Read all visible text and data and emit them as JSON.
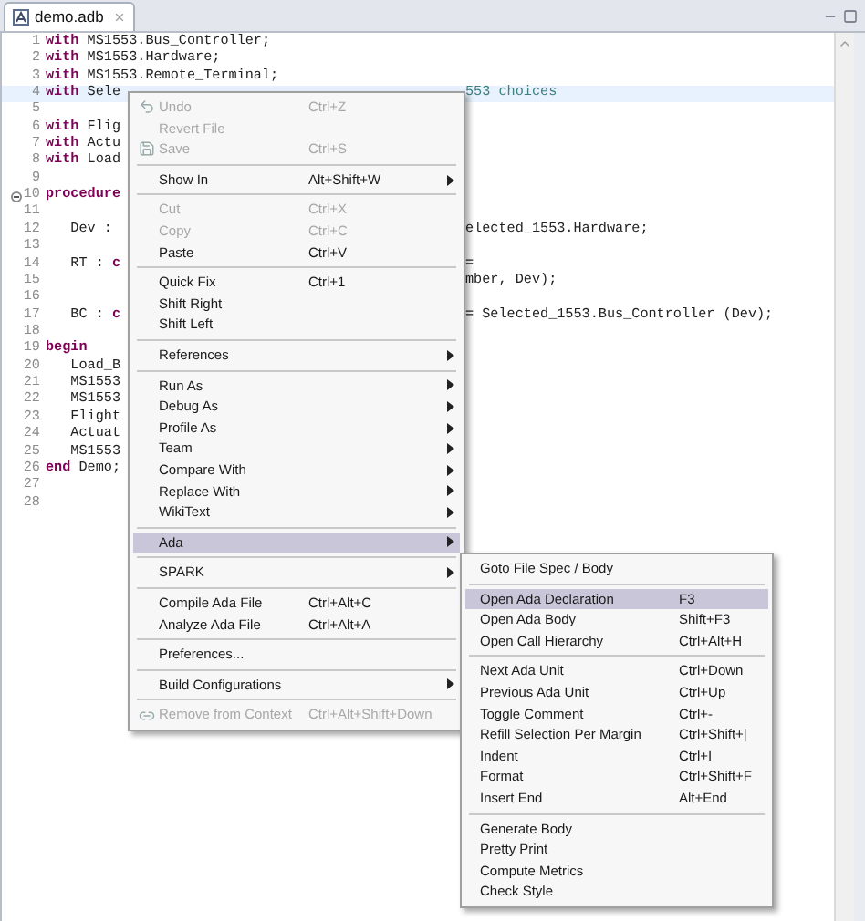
{
  "editor_tab": {
    "title": "demo.adb",
    "selected": true
  },
  "lines": [
    {
      "number": "1",
      "current": false,
      "tokens": [
        {
          "text": "with",
          "kind": "keyword"
        },
        {
          "text": " MS1553.Bus_Controller;",
          "kind": "plain"
        }
      ]
    },
    {
      "number": "2",
      "current": false,
      "tokens": [
        {
          "text": "with",
          "kind": "keyword"
        },
        {
          "text": " MS1553.Hardware;",
          "kind": "plain"
        }
      ]
    },
    {
      "number": "3",
      "current": false,
      "tokens": [
        {
          "text": "with",
          "kind": "keyword"
        },
        {
          "text": " MS1553.Remote_Terminal;",
          "kind": "plain"
        }
      ]
    },
    {
      "number": "4",
      "current": true,
      "tokens": [
        {
          "text": "with",
          "kind": "keyword"
        },
        {
          "text": " Sele",
          "kind": "plain"
        }
      ],
      "right": [
        {
          "text": "553 choices",
          "kind": "comment"
        }
      ]
    },
    {
      "number": "5",
      "current": false
    },
    {
      "number": "6",
      "current": false,
      "tokens": [
        {
          "text": "with",
          "kind": "keyword"
        },
        {
          "text": " Flig",
          "kind": "plain"
        }
      ]
    },
    {
      "number": "7",
      "current": false,
      "tokens": [
        {
          "text": "with",
          "kind": "keyword"
        },
        {
          "text": " Actu",
          "kind": "plain"
        }
      ]
    },
    {
      "number": "8",
      "current": false,
      "tokens": [
        {
          "text": "with",
          "kind": "keyword"
        },
        {
          "text": " Load",
          "kind": "plain"
        }
      ]
    },
    {
      "number": "9",
      "current": false
    },
    {
      "number": "10",
      "current": false,
      "fold_marker": true,
      "tokens": [
        {
          "text": "procedure",
          "kind": "keyword"
        }
      ]
    },
    {
      "number": "11",
      "current": false
    },
    {
      "number": "12",
      "current": false,
      "tokens": [
        {
          "text": "   Dev :",
          "kind": "plain"
        }
      ],
      "right": [
        {
          "text": "elected_1553.Hardware;",
          "kind": "plain"
        }
      ]
    },
    {
      "number": "13",
      "current": false
    },
    {
      "number": "14",
      "current": false,
      "tokens": [
        {
          "text": "   RT : ",
          "kind": "plain"
        },
        {
          "text": "c",
          "kind": "keyword"
        }
      ],
      "right": [
        {
          "text": "=",
          "kind": "plain"
        }
      ]
    },
    {
      "number": "15",
      "current": false,
      "right": [
        {
          "text": "mber, Dev);",
          "kind": "plain"
        }
      ]
    },
    {
      "number": "16",
      "current": false
    },
    {
      "number": "17",
      "current": false,
      "tokens": [
        {
          "text": "   BC : ",
          "kind": "plain"
        },
        {
          "text": "c",
          "kind": "keyword"
        }
      ],
      "right": [
        {
          "text": "= Selected_1553.Bus_Controller (Dev);",
          "kind": "plain"
        }
      ]
    },
    {
      "number": "18",
      "current": false
    },
    {
      "number": "19",
      "current": false,
      "tokens": [
        {
          "text": "begin",
          "kind": "keyword"
        }
      ]
    },
    {
      "number": "20",
      "current": false,
      "tokens": [
        {
          "text": "   Load_B",
          "kind": "plain"
        }
      ]
    },
    {
      "number": "21",
      "current": false,
      "tokens": [
        {
          "text": "   MS1553",
          "kind": "plain"
        }
      ]
    },
    {
      "number": "22",
      "current": false,
      "tokens": [
        {
          "text": "   MS1553",
          "kind": "plain"
        }
      ]
    },
    {
      "number": "23",
      "current": false,
      "tokens": [
        {
          "text": "   Flight",
          "kind": "plain"
        }
      ]
    },
    {
      "number": "24",
      "current": false,
      "tokens": [
        {
          "text": "   Actuat",
          "kind": "plain"
        }
      ]
    },
    {
      "number": "25",
      "current": false,
      "tokens": [
        {
          "text": "   MS1553",
          "kind": "plain"
        }
      ]
    },
    {
      "number": "26",
      "current": false,
      "tokens": [
        {
          "text": "end",
          "kind": "keyword"
        },
        {
          "text": " Demo;",
          "kind": "plain"
        }
      ]
    },
    {
      "number": "27",
      "current": false
    },
    {
      "number": "28",
      "current": false
    }
  ],
  "context_menu": [
    {
      "kind": "item",
      "label": "Undo",
      "shortcut": "Ctrl+Z",
      "disabled": true,
      "selected": false
    },
    {
      "kind": "item",
      "label": "Revert File",
      "disabled": true,
      "selected": false
    },
    {
      "kind": "item",
      "label": "Save",
      "shortcut": "Ctrl+S",
      "disabled": true,
      "selected": false
    },
    {
      "kind": "separator"
    },
    {
      "kind": "item",
      "label": "Show In",
      "shortcut": "Alt+Shift+W",
      "submenu": true,
      "disabled": false,
      "selected": false
    },
    {
      "kind": "separator"
    },
    {
      "kind": "item",
      "label": "Cut",
      "shortcut": "Ctrl+X",
      "disabled": true,
      "selected": false
    },
    {
      "kind": "item",
      "label": "Copy",
      "shortcut": "Ctrl+C",
      "disabled": true,
      "selected": false
    },
    {
      "kind": "item",
      "label": "Paste",
      "shortcut": "Ctrl+V",
      "disabled": false,
      "selected": false
    },
    {
      "kind": "separator"
    },
    {
      "kind": "item",
      "label": "Quick Fix",
      "shortcut": "Ctrl+1",
      "disabled": false,
      "selected": false
    },
    {
      "kind": "item",
      "label": "Shift Right",
      "disabled": false,
      "selected": false
    },
    {
      "kind": "item",
      "label": "Shift Left",
      "disabled": false,
      "selected": false
    },
    {
      "kind": "separator"
    },
    {
      "kind": "item",
      "label": "References",
      "submenu": true,
      "disabled": false,
      "selected": false
    },
    {
      "kind": "separator"
    },
    {
      "kind": "item",
      "label": "Run As",
      "submenu": true,
      "disabled": false,
      "selected": false
    },
    {
      "kind": "item",
      "label": "Debug As",
      "submenu": true,
      "disabled": false,
      "selected": false
    },
    {
      "kind": "item",
      "label": "Profile As",
      "submenu": true,
      "disabled": false,
      "selected": false
    },
    {
      "kind": "item",
      "label": "Team",
      "submenu": true,
      "disabled": false,
      "selected": false
    },
    {
      "kind": "item",
      "label": "Compare With",
      "submenu": true,
      "disabled": false,
      "selected": false
    },
    {
      "kind": "item",
      "label": "Replace With",
      "submenu": true,
      "disabled": false,
      "selected": false
    },
    {
      "kind": "item",
      "label": "WikiText",
      "submenu": true,
      "disabled": false,
      "selected": false
    },
    {
      "kind": "separator"
    },
    {
      "kind": "item",
      "label": "Ada",
      "submenu": true,
      "disabled": false,
      "selected": true
    },
    {
      "kind": "separator"
    },
    {
      "kind": "item",
      "label": "SPARK",
      "submenu": true,
      "disabled": false,
      "selected": false
    },
    {
      "kind": "separator"
    },
    {
      "kind": "item",
      "label": "Compile Ada File",
      "shortcut": "Ctrl+Alt+C",
      "disabled": false,
      "selected": false
    },
    {
      "kind": "item",
      "label": "Analyze Ada File",
      "shortcut": "Ctrl+Alt+A",
      "disabled": false,
      "selected": false
    },
    {
      "kind": "separator"
    },
    {
      "kind": "item",
      "label": "Preferences...",
      "disabled": false,
      "selected": false
    },
    {
      "kind": "separator"
    },
    {
      "kind": "item",
      "label": "Build Configurations",
      "submenu": true,
      "disabled": false,
      "selected": false
    },
    {
      "kind": "separator"
    },
    {
      "kind": "item",
      "label": "Remove from Context",
      "shortcut": "Ctrl+Alt+Shift+Down",
      "disabled": true,
      "selected": false
    }
  ],
  "ada_submenu": [
    {
      "kind": "item",
      "label": "Goto File Spec / Body",
      "disabled": false,
      "selected": false
    },
    {
      "kind": "separator"
    },
    {
      "kind": "item",
      "label": "Open Ada Declaration",
      "shortcut": "F3",
      "disabled": false,
      "selected": true
    },
    {
      "kind": "item",
      "label": "Open Ada Body",
      "shortcut": "Shift+F3",
      "disabled": false,
      "selected": false
    },
    {
      "kind": "item",
      "label": "Open Call Hierarchy",
      "shortcut": "Ctrl+Alt+H",
      "disabled": false,
      "selected": false
    },
    {
      "kind": "separator"
    },
    {
      "kind": "item",
      "label": "Next Ada Unit",
      "shortcut": "Ctrl+Down",
      "disabled": false,
      "selected": false
    },
    {
      "kind": "item",
      "label": "Previous Ada Unit",
      "shortcut": "Ctrl+Up",
      "disabled": false,
      "selected": false
    },
    {
      "kind": "item",
      "label": "Toggle Comment",
      "shortcut": "Ctrl+-",
      "disabled": false,
      "selected": false
    },
    {
      "kind": "item",
      "label": "Refill Selection Per Margin",
      "shortcut": "Ctrl+Shift+|",
      "disabled": false,
      "selected": false
    },
    {
      "kind": "item",
      "label": "Indent",
      "shortcut": "Ctrl+I",
      "disabled": false,
      "selected": false
    },
    {
      "kind": "item",
      "label": "Format",
      "shortcut": "Ctrl+Shift+F",
      "disabled": false,
      "selected": false
    },
    {
      "kind": "item",
      "label": "Insert End",
      "shortcut": "Alt+End",
      "disabled": false,
      "selected": false
    },
    {
      "kind": "separator"
    },
    {
      "kind": "item",
      "label": "Generate Body",
      "disabled": false,
      "selected": false
    },
    {
      "kind": "item",
      "label": "Pretty Print",
      "disabled": false,
      "selected": false
    },
    {
      "kind": "item",
      "label": "Compute Metrics",
      "disabled": false,
      "selected": false
    },
    {
      "kind": "item",
      "label": "Check Style",
      "disabled": false,
      "selected": false
    }
  ]
}
